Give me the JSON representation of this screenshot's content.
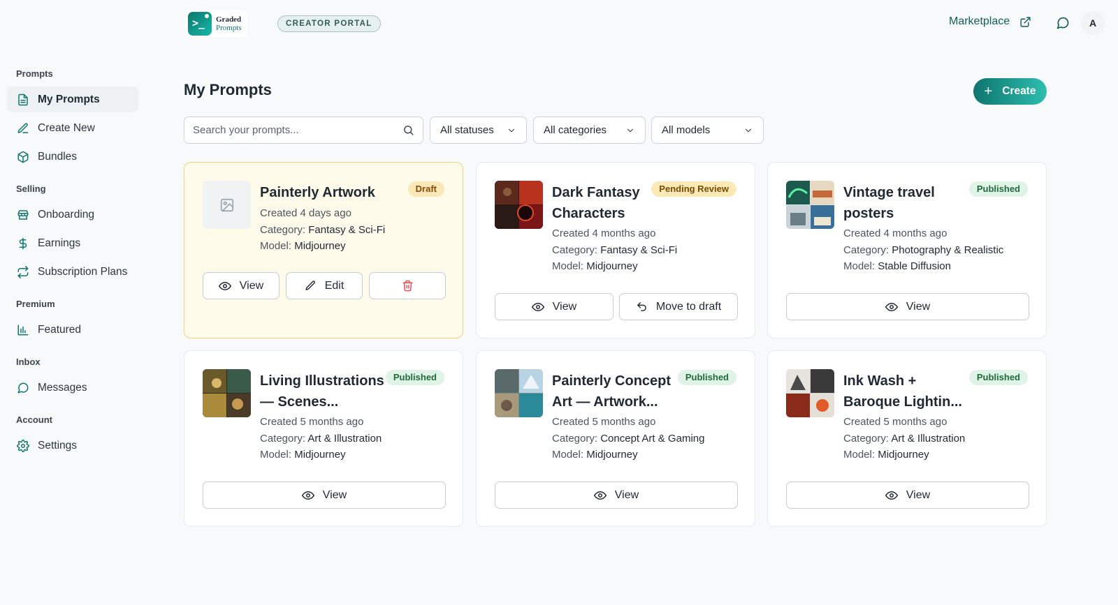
{
  "header": {
    "logo_line1": "Graded",
    "logo_line2": "Prompts",
    "portal_badge": "CREATOR PORTAL",
    "marketplace_link": "Marketplace",
    "avatar_initial": "A"
  },
  "sidebar": {
    "sections": [
      {
        "title": "Prompts",
        "items": [
          {
            "label": "My Prompts",
            "icon": "document-icon",
            "active": true
          },
          {
            "label": "Create New",
            "icon": "pencil-icon"
          },
          {
            "label": "Bundles",
            "icon": "box-icon"
          }
        ]
      },
      {
        "title": "Selling",
        "items": [
          {
            "label": "Onboarding",
            "icon": "store-icon"
          },
          {
            "label": "Earnings",
            "icon": "dollar-icon"
          },
          {
            "label": "Subscription Plans",
            "icon": "repeat-icon"
          }
        ]
      },
      {
        "title": "Premium",
        "items": [
          {
            "label": "Featured",
            "icon": "bar-chart-icon"
          }
        ]
      },
      {
        "title": "Inbox",
        "items": [
          {
            "label": "Messages",
            "icon": "chat-icon"
          }
        ]
      },
      {
        "title": "Account",
        "items": [
          {
            "label": "Settings",
            "icon": "gear-icon"
          }
        ]
      }
    ]
  },
  "main": {
    "title": "My Prompts",
    "create_label": "Create",
    "search_placeholder": "Search your prompts...",
    "filters": {
      "status": "All statuses",
      "category": "All categories",
      "model": "All models"
    },
    "labels": {
      "category": "Category:",
      "model": "Model:",
      "view": "View",
      "edit": "Edit",
      "move_to_draft": "Move to draft"
    },
    "prompts": [
      {
        "title": "Painterly Artwork",
        "status": "Draft",
        "created": "Created 4 days ago",
        "category": "Fantasy & Sci-Fi",
        "model": "Midjourney"
      },
      {
        "title": "Dark Fantasy Characters",
        "status": "Pending Review",
        "created": "Created 4 months ago",
        "category": "Fantasy & Sci-Fi",
        "model": "Midjourney"
      },
      {
        "title": "Vintage travel posters",
        "status": "Published",
        "created": "Created 4 months ago",
        "category": "Photography & Realistic",
        "model": "Stable Diffusion"
      },
      {
        "title": "Living Illustrations — Scenes...",
        "status": "Published",
        "created": "Created 5 months ago",
        "category": "Art & Illustration",
        "model": "Midjourney"
      },
      {
        "title": "Painterly Concept Art — Artwork...",
        "status": "Published",
        "created": "Created 5 months ago",
        "category": "Concept Art & Gaming",
        "model": "Midjourney"
      },
      {
        "title": "Ink Wash + Baroque Lightin...",
        "status": "Published",
        "created": "Created 5 months ago",
        "category": "Art & Illustration",
        "model": "Midjourney"
      }
    ]
  },
  "colors": {
    "accent": "#0f766e",
    "draft_bg": "#fffbea",
    "published_badge": "#dff3e6",
    "pending_badge": "#fbeab5"
  }
}
